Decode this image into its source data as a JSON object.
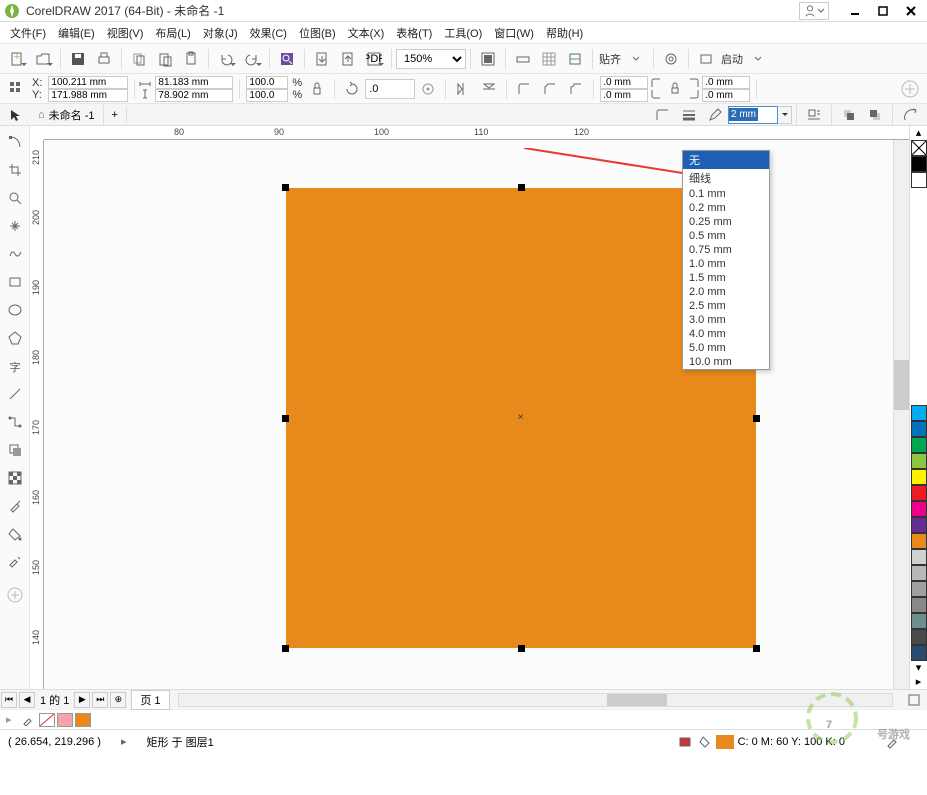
{
  "title": "CorelDRAW 2017 (64-Bit) - 未命名 -1",
  "menu": [
    "文件(F)",
    "编辑(E)",
    "视图(V)",
    "布局(L)",
    "对象(J)",
    "效果(C)",
    "位图(B)",
    "文本(X)",
    "表格(T)",
    "工具(O)",
    "窗口(W)",
    "帮助(H)"
  ],
  "toolbar": {
    "zoom": "150%",
    "align": "贴齐",
    "launch": "启动"
  },
  "prop": {
    "x": "100.211 mm",
    "y": "171.988 mm",
    "w": "81.183 mm",
    "h": "78.902 mm",
    "sx": "100.0",
    "sy": "100.0",
    "pct": "%",
    "rot": ".0",
    "ow1": ".0 mm",
    "ow2": ".0 mm",
    "ow3": ".0 mm",
    "ow4": ".0 mm"
  },
  "doctab": "未命名 -1",
  "outline_width": "2 mm",
  "dropdown": [
    "无",
    "细线",
    "0.1 mm",
    "0.2 mm",
    "0.25 mm",
    "0.5 mm",
    "0.75 mm",
    "1.0 mm",
    "1.5 mm",
    "2.0 mm",
    "2.5 mm",
    "3.0 mm",
    "4.0 mm",
    "5.0 mm",
    "10.0 mm"
  ],
  "ruler_h": [
    "80",
    "90",
    "100",
    "110",
    "120"
  ],
  "ruler_v": [
    "140",
    "150",
    "160",
    "170",
    "180",
    "190",
    "200",
    "210"
  ],
  "page": {
    "count": "1 的 1",
    "tab": "页 1"
  },
  "status": {
    "coords": "( 26.654, 219.296 )",
    "obj": "矩形 于 图层1",
    "fill": "C: 0 M: 60 Y: 100 K: 0"
  },
  "palette": [
    "#000000",
    "#ffffff",
    "#00aeef",
    "#0072bc",
    "#2e3192",
    "#662d91",
    "#00a651",
    "#8dc63f",
    "#fff200",
    "#f7941d",
    "#ed1c24",
    "#ec008c",
    "#898989",
    "#e8891c",
    "#c0c0c0",
    "#a0a0a0",
    "#808080",
    "#606060",
    "#404040",
    "#2f4f4f",
    "#556b2f",
    "#000080"
  ],
  "watermark": "7号游戏"
}
